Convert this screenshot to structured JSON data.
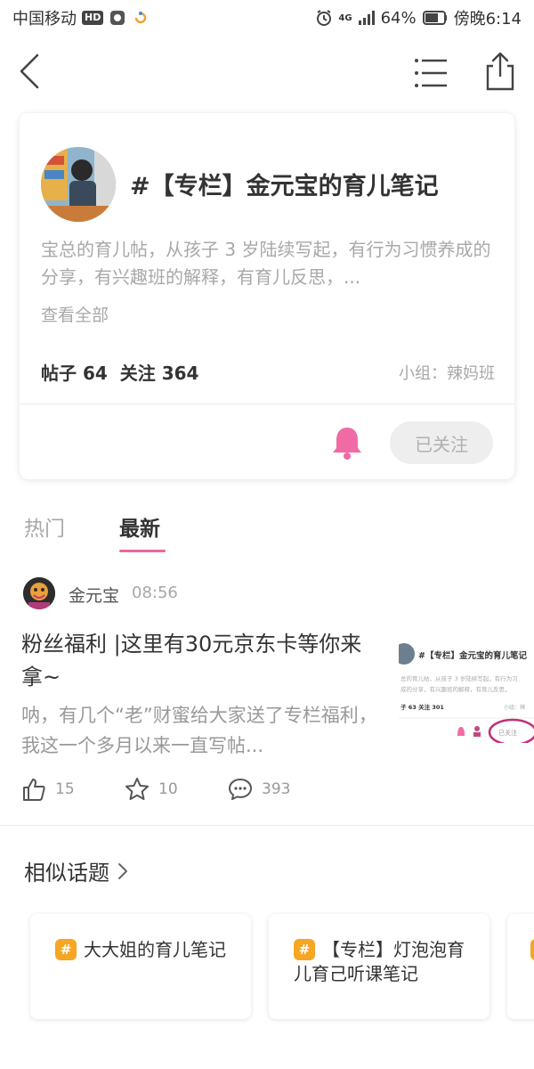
{
  "status_bar": {
    "carrier": "中国移动",
    "hd_badge": "HD",
    "network": "4G",
    "battery": "64%",
    "time": "傍晚6:14"
  },
  "topic": {
    "title": "#【专栏】金元宝的育儿笔记",
    "description": "宝总的育儿帖，从孩子 3 岁陆续写起，有行为习惯养成的分享，有兴趣班的解释，有育儿反思，...",
    "see_all": "查看全部",
    "posts_label": "帖子",
    "posts_count": "64",
    "follows_label": "关注",
    "follows_count": "364",
    "group": "小组：辣妈班",
    "follow_button": "已关注"
  },
  "tabs": [
    {
      "label": "热门",
      "active": false
    },
    {
      "label": "最新",
      "active": true
    }
  ],
  "post": {
    "author": "金元宝",
    "time": "08:56",
    "title": "粉丝福利 |这里有30元京东卡等你来拿~",
    "excerpt": "呐，有几个“老”财蜜给大家送了专栏福利，我这一个多月以来一直写帖...",
    "likes": "15",
    "favorites": "10",
    "comments": "393",
    "thumbnail": {
      "title": "#【专栏】金元宝的育儿笔记",
      "line1": "总的育儿帖，从孩子 3 岁陆续写起，有行为习",
      "line2": "成的分享，有兴趣班的解释，有育儿反思，",
      "stats": "子 63  关注 301",
      "group": "小组：辣",
      "button": "已关注"
    }
  },
  "similar": {
    "title": "相似话题",
    "items": [
      {
        "badge": "#",
        "label": "大大姐的育儿笔记"
      },
      {
        "badge": "#",
        "label": "【专栏】灯泡泡育儿育己听课笔记"
      },
      {
        "badge": "#",
        "label": ""
      }
    ]
  },
  "colors": {
    "accent_pink": "#e8689a",
    "bell_pink": "#f06ba6",
    "badge_orange": "#f5a623"
  }
}
